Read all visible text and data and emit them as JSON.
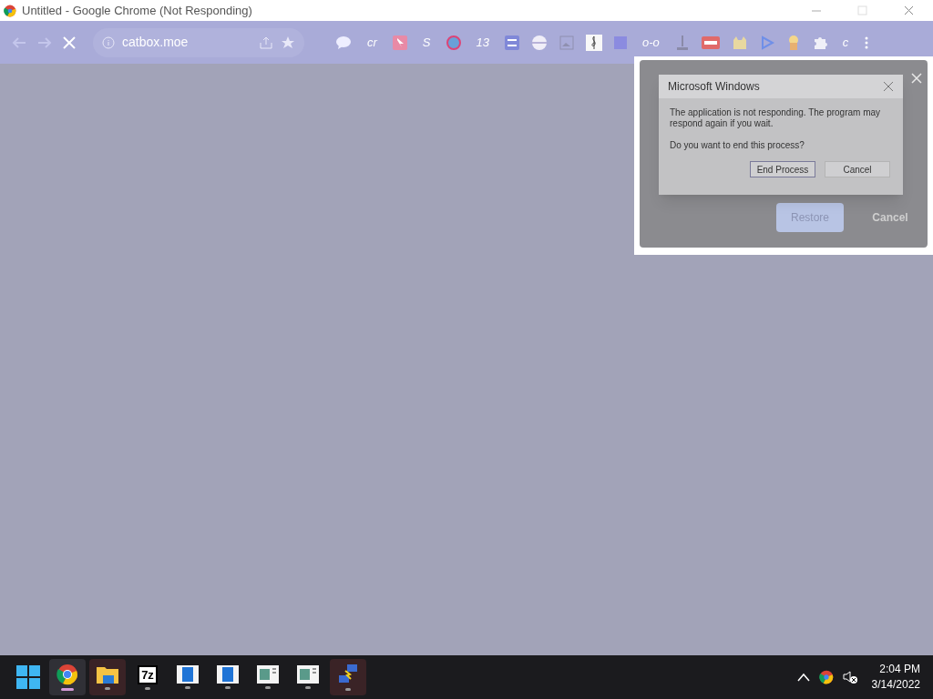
{
  "window": {
    "title": "Untitled - Google Chrome (Not Responding)"
  },
  "toolbar": {
    "address": "catbox.moe",
    "extensions": [
      {
        "kind": "bubble"
      },
      {
        "kind": "text",
        "label": "cr"
      },
      {
        "kind": "pointer"
      },
      {
        "kind": "text",
        "label": "S"
      },
      {
        "kind": "globe"
      },
      {
        "kind": "text",
        "label": "13"
      },
      {
        "kind": "sliders"
      },
      {
        "kind": "ball"
      },
      {
        "kind": "image"
      },
      {
        "kind": "clef"
      },
      {
        "kind": "square"
      },
      {
        "kind": "text",
        "label": "o-o"
      },
      {
        "kind": "stand"
      },
      {
        "kind": "card"
      },
      {
        "kind": "dog"
      },
      {
        "kind": "play"
      },
      {
        "kind": "cup"
      },
      {
        "kind": "puzzle"
      },
      {
        "kind": "text",
        "label": "c"
      }
    ]
  },
  "restore_dialog": {
    "buttons": [
      {
        "label": "Restore",
        "primary": true
      },
      {
        "label": "Cancel",
        "primary": false
      }
    ]
  },
  "not_responding_dialog": {
    "title": "Microsoft Windows",
    "message": "The application is not responding. The program may respond again if you wait.",
    "question": "Do you want to end this process?",
    "buttons": [
      {
        "label": "End Process",
        "focused": true
      },
      {
        "label": "Cancel",
        "focused": false
      }
    ]
  },
  "taskbar": {
    "apps": [
      {
        "kind": "chrome",
        "active": true,
        "running": true
      },
      {
        "kind": "folder",
        "active": false,
        "running": true
      },
      {
        "kind": "archive",
        "label": "7z",
        "active": false,
        "running": true
      },
      {
        "kind": "doc",
        "active": false,
        "running": true
      },
      {
        "kind": "doc",
        "active": false,
        "running": true
      },
      {
        "kind": "sheet",
        "active": false,
        "running": true
      },
      {
        "kind": "sheet",
        "active": false,
        "running": true
      },
      {
        "kind": "network",
        "active": false,
        "running": true
      }
    ],
    "time": "2:04 PM",
    "date": "3/14/2022"
  }
}
